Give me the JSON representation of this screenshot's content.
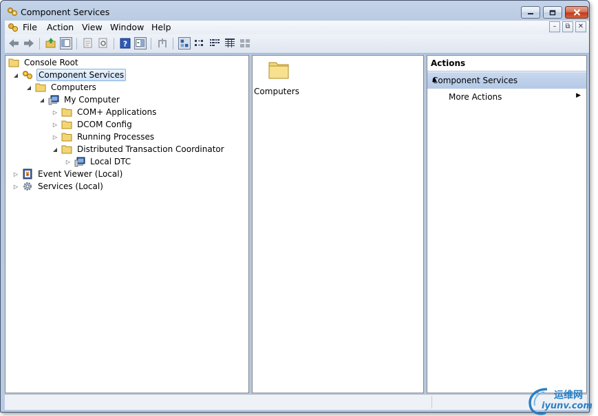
{
  "window": {
    "title": "Component Services"
  },
  "menu": [
    "File",
    "Action",
    "View",
    "Window",
    "Help"
  ],
  "mdi_controls": [
    "–",
    "⧉",
    "✕"
  ],
  "tree": [
    {
      "label": "Console Root",
      "icon": "folder-icon",
      "expander": "",
      "selected": false
    },
    {
      "label": "Component Services",
      "icon": "component-services-icon",
      "expander": "expanded",
      "selected": true
    },
    {
      "label": "Computers",
      "icon": "folder-icon",
      "expander": "expanded",
      "selected": false
    },
    {
      "label": "My Computer",
      "icon": "computer-icon",
      "expander": "expanded",
      "selected": false
    },
    {
      "label": "COM+ Applications",
      "icon": "folder-icon",
      "expander": "collapsed",
      "selected": false
    },
    {
      "label": "DCOM Config",
      "icon": "folder-icon",
      "expander": "collapsed",
      "selected": false
    },
    {
      "label": "Running Processes",
      "icon": "folder-icon",
      "expander": "collapsed",
      "selected": false
    },
    {
      "label": "Distributed Transaction Coordinator",
      "icon": "folder-icon",
      "expander": "expanded",
      "selected": false
    },
    {
      "label": "Local DTC",
      "icon": "computer-icon",
      "expander": "collapsed",
      "selected": false
    },
    {
      "label": "Event Viewer (Local)",
      "icon": "event-viewer-icon",
      "expander": "collapsed",
      "selected": false
    },
    {
      "label": "Services (Local)",
      "icon": "services-gear-icon",
      "expander": "collapsed",
      "selected": false
    }
  ],
  "list": {
    "items": [
      {
        "label": "Computers",
        "icon": "folder-icon"
      }
    ]
  },
  "actions": {
    "header": "Actions",
    "group": "Component Services",
    "items": [
      "More Actions"
    ]
  },
  "watermark": {
    "cn": "运维网",
    "en": "iyunv.com"
  },
  "colors": {
    "frame": "#b9cbe2",
    "selection": "#cfe4fa",
    "action_group": "#b4c9e6",
    "watermark": "#2b7fc4"
  }
}
